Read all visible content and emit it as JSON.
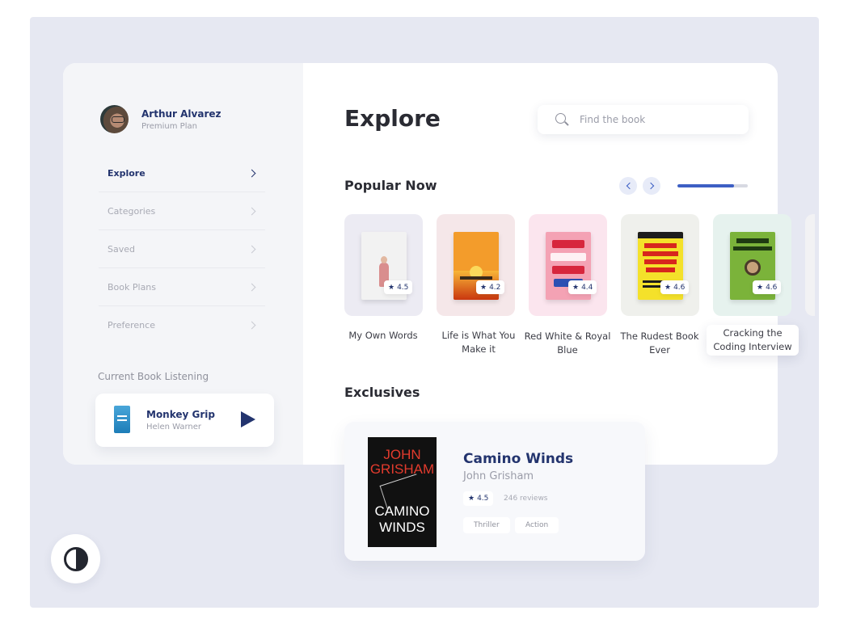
{
  "user": {
    "name": "Arthur Alvarez",
    "plan": "Premium Plan"
  },
  "nav": [
    {
      "label": "Explore",
      "active": true
    },
    {
      "label": "Categories",
      "active": false
    },
    {
      "label": "Saved",
      "active": false
    },
    {
      "label": "Book Plans",
      "active": false
    },
    {
      "label": "Preference",
      "active": false
    }
  ],
  "listening": {
    "heading": "Current Book Listening",
    "title": "Monkey Grip",
    "author": "Helen Warner"
  },
  "main": {
    "title": "Explore",
    "search": {
      "placeholder": "Find the book",
      "value": ""
    },
    "popular": {
      "heading": "Popular Now",
      "progress": 0.8,
      "books": [
        {
          "title": "My Own Words",
          "rating": "4.5",
          "bg": "#ecebf3",
          "cover": "#f2f2f2"
        },
        {
          "title": "Life is What You Make it",
          "rating": "4.2",
          "bg": "#f5e7e9",
          "cover": "#f39c2b"
        },
        {
          "title": "Red White & Royal Blue",
          "rating": "4.4",
          "bg": "#fbe5ee",
          "cover": "#f4a2b4"
        },
        {
          "title": "The Rudest Book Ever",
          "rating": "4.6",
          "bg": "#eff0ec",
          "cover": "#f4e12a"
        },
        {
          "title": "Cracking the Coding Interview",
          "rating": "4.6",
          "bg": "#e6f2ee",
          "cover": "#7bb33a"
        }
      ]
    },
    "exclusives": {
      "heading": "Exclusives",
      "title": "Camino Winds",
      "author": "John Grisham",
      "rating": "4.5",
      "reviews": "246 reviews",
      "tags": [
        "Thriller",
        "Action"
      ],
      "cover_author": "JOHN GRISHAM",
      "cover_title": "CAMINO WINDS"
    }
  },
  "colors": {
    "accent": "#3d5fc4",
    "navy": "#23346e",
    "frame": "#e6e8f2"
  }
}
